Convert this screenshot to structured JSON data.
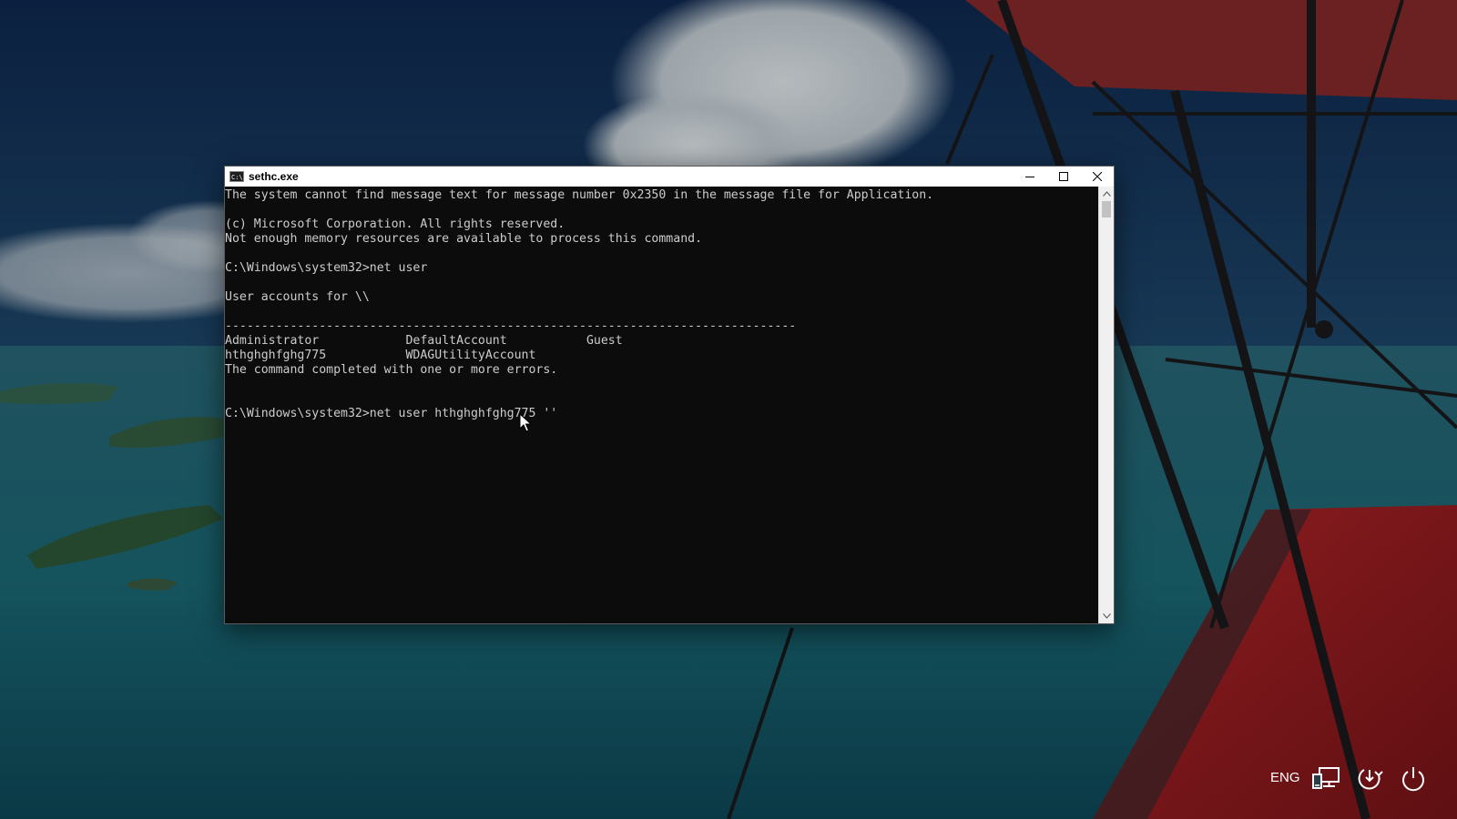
{
  "window": {
    "title": "sethc.exe",
    "icon_label": "C:\\",
    "controls": {
      "minimize_icon": "minimize-icon",
      "maximize_icon": "maximize-icon",
      "close_icon": "close-icon"
    }
  },
  "console": {
    "lines": [
      "The system cannot find message text for message number 0x2350 in the message file for Application.",
      "",
      "(c) Microsoft Corporation. All rights reserved.",
      "Not enough memory resources are available to process this command.",
      "",
      "C:\\Windows\\system32>net user",
      "",
      "User accounts for \\\\",
      "",
      "-------------------------------------------------------------------------------",
      "Administrator            DefaultAccount           Guest",
      "hthghghfghg775           WDAGUtilityAccount",
      "The command completed with one or more errors.",
      "",
      "",
      "C:\\Windows\\system32>net user hthghghfghg775 ''"
    ]
  },
  "tray": {
    "language": "ENG",
    "network_icon": "network-icon",
    "ease_of_access_icon": "ease-of-access-icon",
    "power_icon": "power-icon"
  },
  "colors": {
    "console_bg": "#0c0c0c",
    "console_text": "#cccccc",
    "titlebar_bg": "#ffffff"
  }
}
